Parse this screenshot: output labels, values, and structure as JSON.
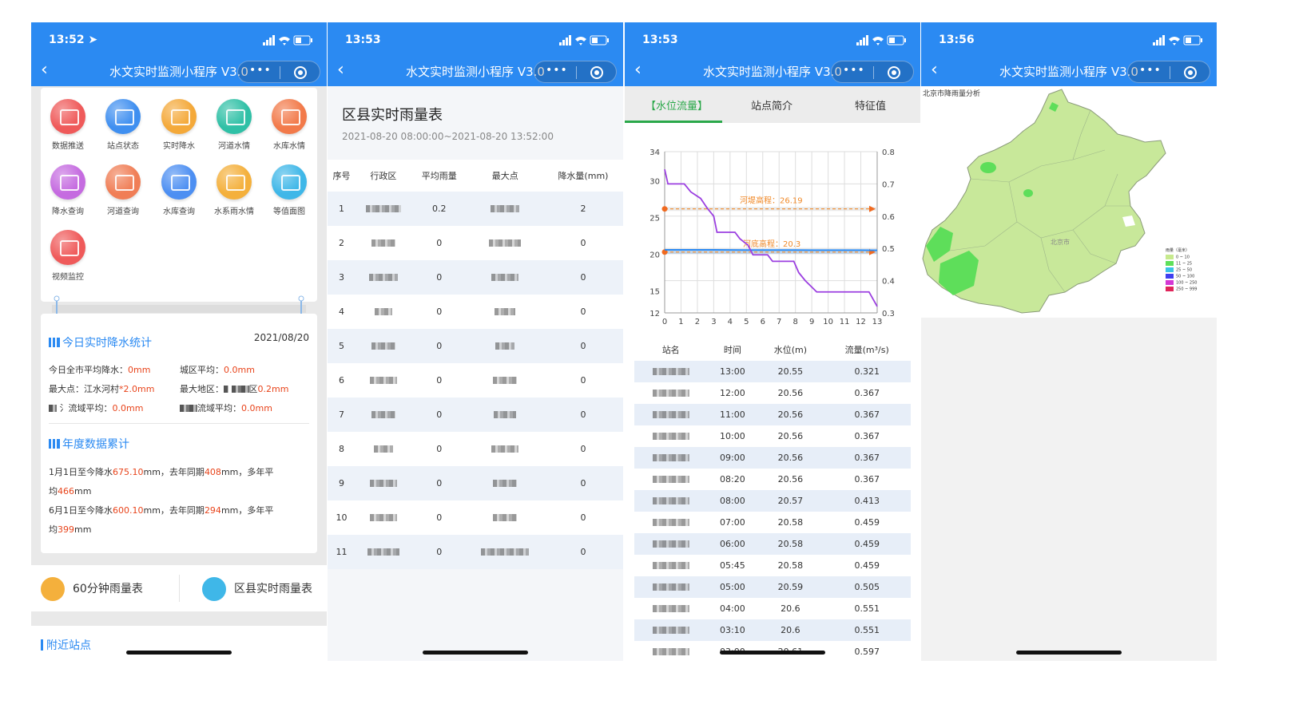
{
  "app_title": "水文实时监测小程序 V3.0",
  "capsule": {
    "dots": "•••"
  },
  "screens": [
    {
      "time": "13:52 ➤"
    },
    {
      "time": "13:53"
    },
    {
      "time": "13:53"
    },
    {
      "time": "13:56"
    }
  ],
  "menu": [
    {
      "label": "数据推送",
      "color": "#ef5a5a"
    },
    {
      "label": "站点状态",
      "color": "#3f8ff0"
    },
    {
      "label": "实时降水",
      "color": "#f4a93a"
    },
    {
      "label": "河道水情",
      "color": "#2fc0a6"
    },
    {
      "label": "水库水情",
      "color": "#f27a4a"
    },
    {
      "label": "降水查询",
      "color": "#c56be0"
    },
    {
      "label": "河道查询",
      "color": "#f07e56"
    },
    {
      "label": "水库查询",
      "color": "#4d8ff2"
    },
    {
      "label": "水系雨水情",
      "color": "#f4b03c"
    },
    {
      "label": "等值面图",
      "color": "#3fb7e8"
    },
    {
      "label": "视频监控",
      "color": "#ef5a5a"
    }
  ],
  "today": {
    "title": "今日实时降水统计",
    "date": "2021/08/20",
    "city_avg_label": "今日全市平均降水：",
    "city_avg": "0mm",
    "urban_avg_label": "城区平均：",
    "urban_avg": "0.0mm",
    "max_point_label": "最大点：江水河村",
    "max_point": "2.0mm",
    "max_area_label": "最大地区：",
    "max_area_suffix": "区",
    "max_area": "0.2mm",
    "basin1_label": "流域平均：",
    "basin1": "0.0mm",
    "basin2_label": "流域平均：",
    "basin2": "0.0mm"
  },
  "annual": {
    "title": "年度数据累计",
    "l1a": "1月1日至今降水",
    "l1v": "675.10",
    "l1b": "mm，去年同期",
    "l1w": "408",
    "l1c": "mm，多年平",
    "l2a": "均",
    "l2v": "466",
    "l2b": "mm",
    "l3a": "6月1日至今降水",
    "l3v": "600.10",
    "l3b": "mm，去年同期",
    "l3w": "294",
    "l3c": "mm，多年平",
    "l4a": "均",
    "l4v": "399",
    "l4b": "mm"
  },
  "bottom": {
    "left": "60分钟雨量表",
    "right": "区县实时雨量表",
    "nearby": "附近站点"
  },
  "rain_table": {
    "title": "区县实时雨量表",
    "range": "2021-08-20 08:00:00~2021-08-20 13:52:00",
    "headers": [
      "序号",
      "行政区",
      "平均雨量",
      "最大点",
      "降水量(mm)"
    ],
    "rows": [
      [
        "1",
        "0.2",
        "2"
      ],
      [
        "2",
        "0",
        "0"
      ],
      [
        "3",
        "0",
        "0"
      ],
      [
        "4",
        "0",
        "0"
      ],
      [
        "5",
        "0",
        "0"
      ],
      [
        "6",
        "0",
        "0"
      ],
      [
        "7",
        "0",
        "0"
      ],
      [
        "8",
        "0",
        "0"
      ],
      [
        "9",
        "0",
        "0"
      ],
      [
        "10",
        "0",
        "0"
      ],
      [
        "11",
        "0",
        "0"
      ]
    ]
  },
  "tabs": [
    "【水位流量】",
    "站点简介",
    "特征值"
  ],
  "chart_data": {
    "type": "line",
    "x": [
      0,
      1,
      2,
      3,
      4,
      5,
      6,
      7,
      8,
      9,
      10,
      11,
      12,
      13
    ],
    "x_ticks": [
      "0",
      "1",
      "2",
      "3",
      "4",
      "5",
      "6",
      "7",
      "8",
      "9",
      "10",
      "11",
      "12",
      "13"
    ],
    "y_ticks": [
      "12",
      "15",
      "20",
      "25",
      "30",
      "34"
    ],
    "y2_ticks": [
      "0.3",
      "0.4",
      "0.5",
      "0.6",
      "0.7",
      "0.8"
    ],
    "ylim": [
      12,
      34
    ],
    "y2lim": [
      0.3,
      0.8
    ],
    "annotations": [
      {
        "label": "河堤高程：26.19",
        "value": 26.19
      },
      {
        "label": "河底高程：20.3",
        "value": 20.3
      }
    ],
    "series": [
      {
        "axis": "left",
        "values": [
          20.61,
          20.61,
          20.6,
          20.6,
          20.59,
          20.58,
          20.58,
          20.58,
          20.57,
          20.56,
          20.56,
          20.56,
          20.56,
          20.55
        ]
      },
      {
        "axis": "right",
        "points": [
          [
            0,
            0.745
          ],
          [
            0.2,
            0.7
          ],
          [
            1.2,
            0.7
          ],
          [
            1.6,
            0.675
          ],
          [
            2.2,
            0.655
          ],
          [
            2.6,
            0.625
          ],
          [
            3,
            0.6
          ],
          [
            3.2,
            0.55
          ],
          [
            4.3,
            0.55
          ],
          [
            4.6,
            0.53
          ],
          [
            5.1,
            0.51
          ],
          [
            5.4,
            0.48
          ],
          [
            6.3,
            0.48
          ],
          [
            6.6,
            0.46
          ],
          [
            7.9,
            0.46
          ],
          [
            8.2,
            0.425
          ],
          [
            8.6,
            0.4
          ],
          [
            9.3,
            0.365
          ],
          [
            12.5,
            0.365
          ],
          [
            13,
            0.32
          ]
        ]
      }
    ]
  },
  "water_table": {
    "headers": [
      "站名",
      "时间",
      "水位(m)",
      "流量(m³/s)"
    ],
    "rows": [
      [
        "13:00",
        "20.55",
        "0.321"
      ],
      [
        "12:00",
        "20.56",
        "0.367"
      ],
      [
        "11:00",
        "20.56",
        "0.367"
      ],
      [
        "10:00",
        "20.56",
        "0.367"
      ],
      [
        "09:00",
        "20.56",
        "0.367"
      ],
      [
        "08:20",
        "20.56",
        "0.367"
      ],
      [
        "08:00",
        "20.57",
        "0.413"
      ],
      [
        "07:00",
        "20.58",
        "0.459"
      ],
      [
        "06:00",
        "20.58",
        "0.459"
      ],
      [
        "05:45",
        "20.58",
        "0.459"
      ],
      [
        "05:00",
        "20.59",
        "0.505"
      ],
      [
        "04:00",
        "20.6",
        "0.551"
      ],
      [
        "03:10",
        "20.6",
        "0.551"
      ],
      [
        "03:00",
        "20.61",
        "0.597"
      ]
    ]
  },
  "map": {
    "title": "北京市降雨量分析",
    "center_label": "北京市",
    "legend_title": "雨量（毫米）",
    "legend": [
      {
        "label": "0 ~ 10",
        "color": "#c7ea8e"
      },
      {
        "label": "11 ~ 25",
        "color": "#5ee05a"
      },
      {
        "label": "25 ~ 50",
        "color": "#3ac3e6"
      },
      {
        "label": "50 ~ 100",
        "color": "#3f3ff0"
      },
      {
        "label": "100 ~ 250",
        "color": "#d437d4"
      },
      {
        "label": "250 ~ 999",
        "color": "#e0245a"
      }
    ]
  }
}
